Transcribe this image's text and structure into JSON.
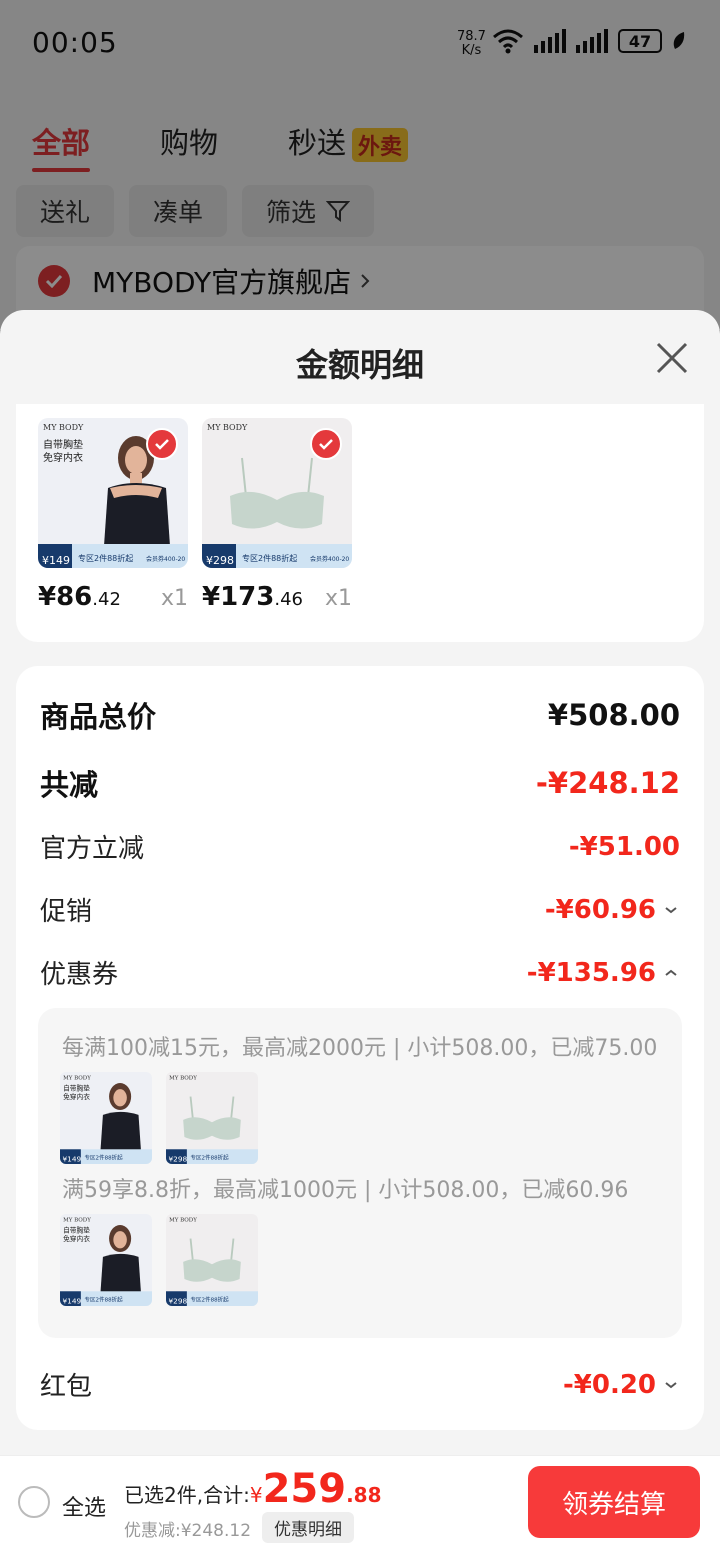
{
  "status_bar": {
    "time": "00:05",
    "net_speed_value": "78.7",
    "net_speed_unit": "K/s",
    "battery": "47"
  },
  "top_tabs": [
    {
      "label": "全部",
      "active": true
    },
    {
      "label": "购物",
      "active": false
    },
    {
      "label": "秒送",
      "active": false,
      "badge": "外卖"
    }
  ],
  "filters": [
    "送礼",
    "凑单",
    "筛选"
  ],
  "store": {
    "name": "MYBODY官方旗舰店"
  },
  "sheet": {
    "title": "金额明细",
    "items": [
      {
        "price_int": "¥86",
        "price_dec": ".42",
        "qty": "x1",
        "brand": "MY BODY",
        "promo_title_1": "自带胸垫",
        "promo_title_2": "免穿内衣",
        "tag": "专区2件88折起",
        "tag_price": "149",
        "checked": true
      },
      {
        "price_int": "¥173",
        "price_dec": ".46",
        "qty": "x1",
        "brand": "MY BODY",
        "tag": "专区2件88折起",
        "tag_price": "298",
        "checked": true
      }
    ],
    "rows": {
      "goods_total_label": "商品总价",
      "goods_total_value": "¥508.00",
      "total_discount_label": "共减",
      "total_discount_value": "-¥248.12",
      "official_label": "官方立减",
      "official_value": "-¥51.00",
      "promo_label": "促销",
      "promo_value": "-¥60.96",
      "coupon_label": "优惠券",
      "coupon_value": "-¥135.96",
      "redpack_label": "红包",
      "redpack_value": "-¥0.20"
    },
    "coupon_rules": [
      "每满100减15元，最高减2000元 | 小计508.00，已减75.00",
      "满59享8.8折，最高减1000元 | 小计508.00，已减60.96"
    ]
  },
  "bottom_bar": {
    "select_all": "全选",
    "selected_text": "已选2件,合计:",
    "currency": "¥",
    "total_int": "259",
    "total_dec": ".88",
    "discount_text": "优惠减:¥248.12",
    "detail_chip": "优惠明细",
    "checkout": "领券结算"
  },
  "colors": {
    "accent_red": "#f2271c",
    "button_red": "#f73a3a",
    "badge_yellow": "#f7c531"
  }
}
